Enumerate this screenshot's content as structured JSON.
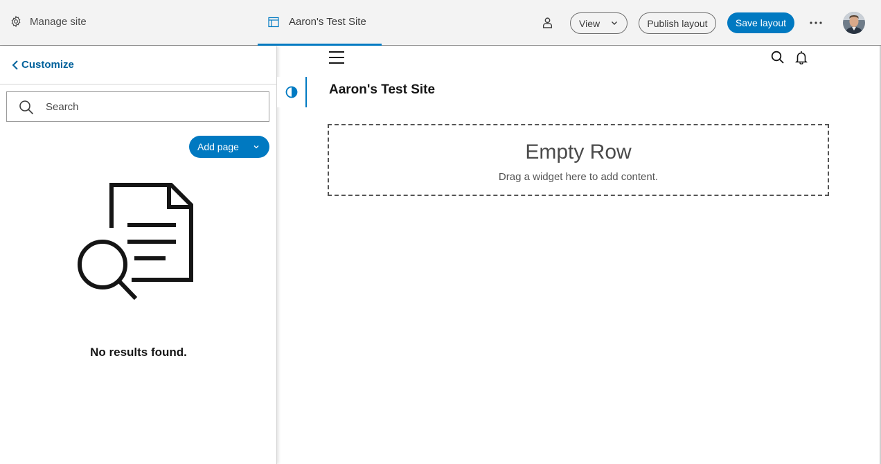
{
  "topbar": {
    "manage_site_label": "Manage site",
    "site_tab_label": "Aaron's Test Site",
    "view_label": "View",
    "publish_label": "Publish layout",
    "save_label": "Save layout"
  },
  "sidebar": {
    "back_label": "Customize",
    "search_placeholder": "Search",
    "add_page_label": "Add page",
    "empty_message": "No results found."
  },
  "canvas": {
    "site_title": "Aaron's Test Site",
    "empty_row_title": "Empty Row",
    "empty_row_hint": "Drag a widget here to add content."
  },
  "colors": {
    "accent": "#0079c1",
    "link": "#00619b",
    "topbar_bg": "#f3f3f3"
  },
  "icons": [
    "gear-icon",
    "layout-icon",
    "person-icon",
    "chevron-down-icon",
    "more-icon",
    "chevron-left-icon",
    "search-icon",
    "document-search-icon",
    "contrast-icon",
    "hamburger-icon",
    "bell-icon"
  ]
}
